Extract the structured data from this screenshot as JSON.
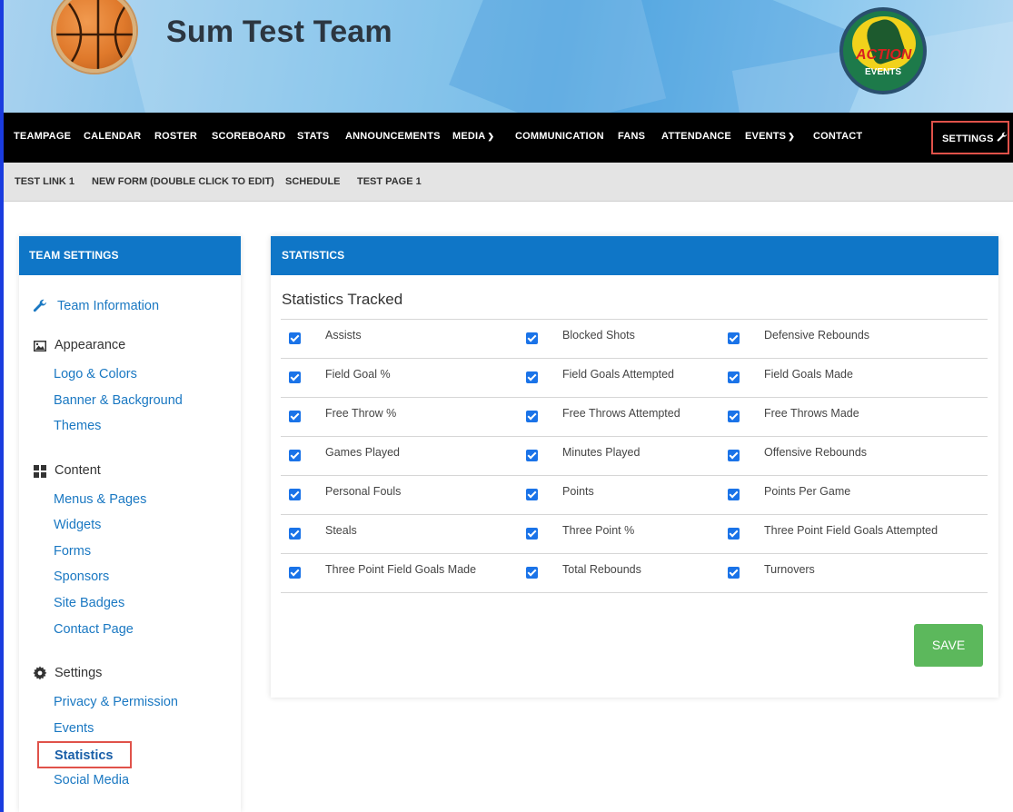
{
  "header": {
    "team_name": "Sum Test Team",
    "logo_action_text": "ACTION",
    "logo_events_text": "EVENTS"
  },
  "main_nav": {
    "items": [
      "TEAMPAGE",
      "CALENDAR",
      "ROSTER",
      "SCOREBOARD",
      "STATS",
      "ANNOUNCEMENTS",
      "MEDIA",
      "COMMUNICATION",
      "FANS",
      "ATTENDANCE",
      "EVENTS",
      "CONTACT"
    ],
    "settings": "SETTINGS"
  },
  "sub_nav": {
    "items": [
      "TEST LINK 1",
      "NEW FORM (DOUBLE CLICK TO EDIT)",
      "SCHEDULE",
      "TEST PAGE 1"
    ]
  },
  "sidebar": {
    "title": "TEAM SETTINGS",
    "team_information": "Team Information",
    "appearance": {
      "heading": "Appearance",
      "links": [
        "Logo & Colors",
        "Banner & Background",
        "Themes"
      ]
    },
    "content": {
      "heading": "Content",
      "links": [
        "Menus & Pages",
        "Widgets",
        "Forms",
        "Sponsors",
        "Site Badges",
        "Contact Page"
      ]
    },
    "settings": {
      "heading": "Settings",
      "links": [
        "Privacy & Permission",
        "Events",
        "Statistics",
        "Social Media"
      ]
    }
  },
  "statistics": {
    "title": "STATISTICS",
    "subtitle": "Statistics Tracked",
    "rows": [
      [
        "Assists",
        "Blocked Shots",
        "Defensive Rebounds"
      ],
      [
        "Field Goal %",
        "Field Goals Attempted",
        "Field Goals Made"
      ],
      [
        "Free Throw %",
        "Free Throws Attempted",
        "Free Throws Made"
      ],
      [
        "Games Played",
        "Minutes Played",
        "Offensive Rebounds"
      ],
      [
        "Personal Fouls",
        "Points",
        "Points Per Game"
      ],
      [
        "Steals",
        "Three Point %",
        "Three Point Field Goals Attempted"
      ],
      [
        "Three Point Field Goals Made",
        "Total Rebounds",
        "Turnovers"
      ]
    ],
    "save_label": "SAVE"
  },
  "colors": {
    "primary_blue": "#0f76c7",
    "link_blue": "#1a78c2",
    "save_green": "#5cb85c",
    "highlight_red": "#e0524a"
  }
}
